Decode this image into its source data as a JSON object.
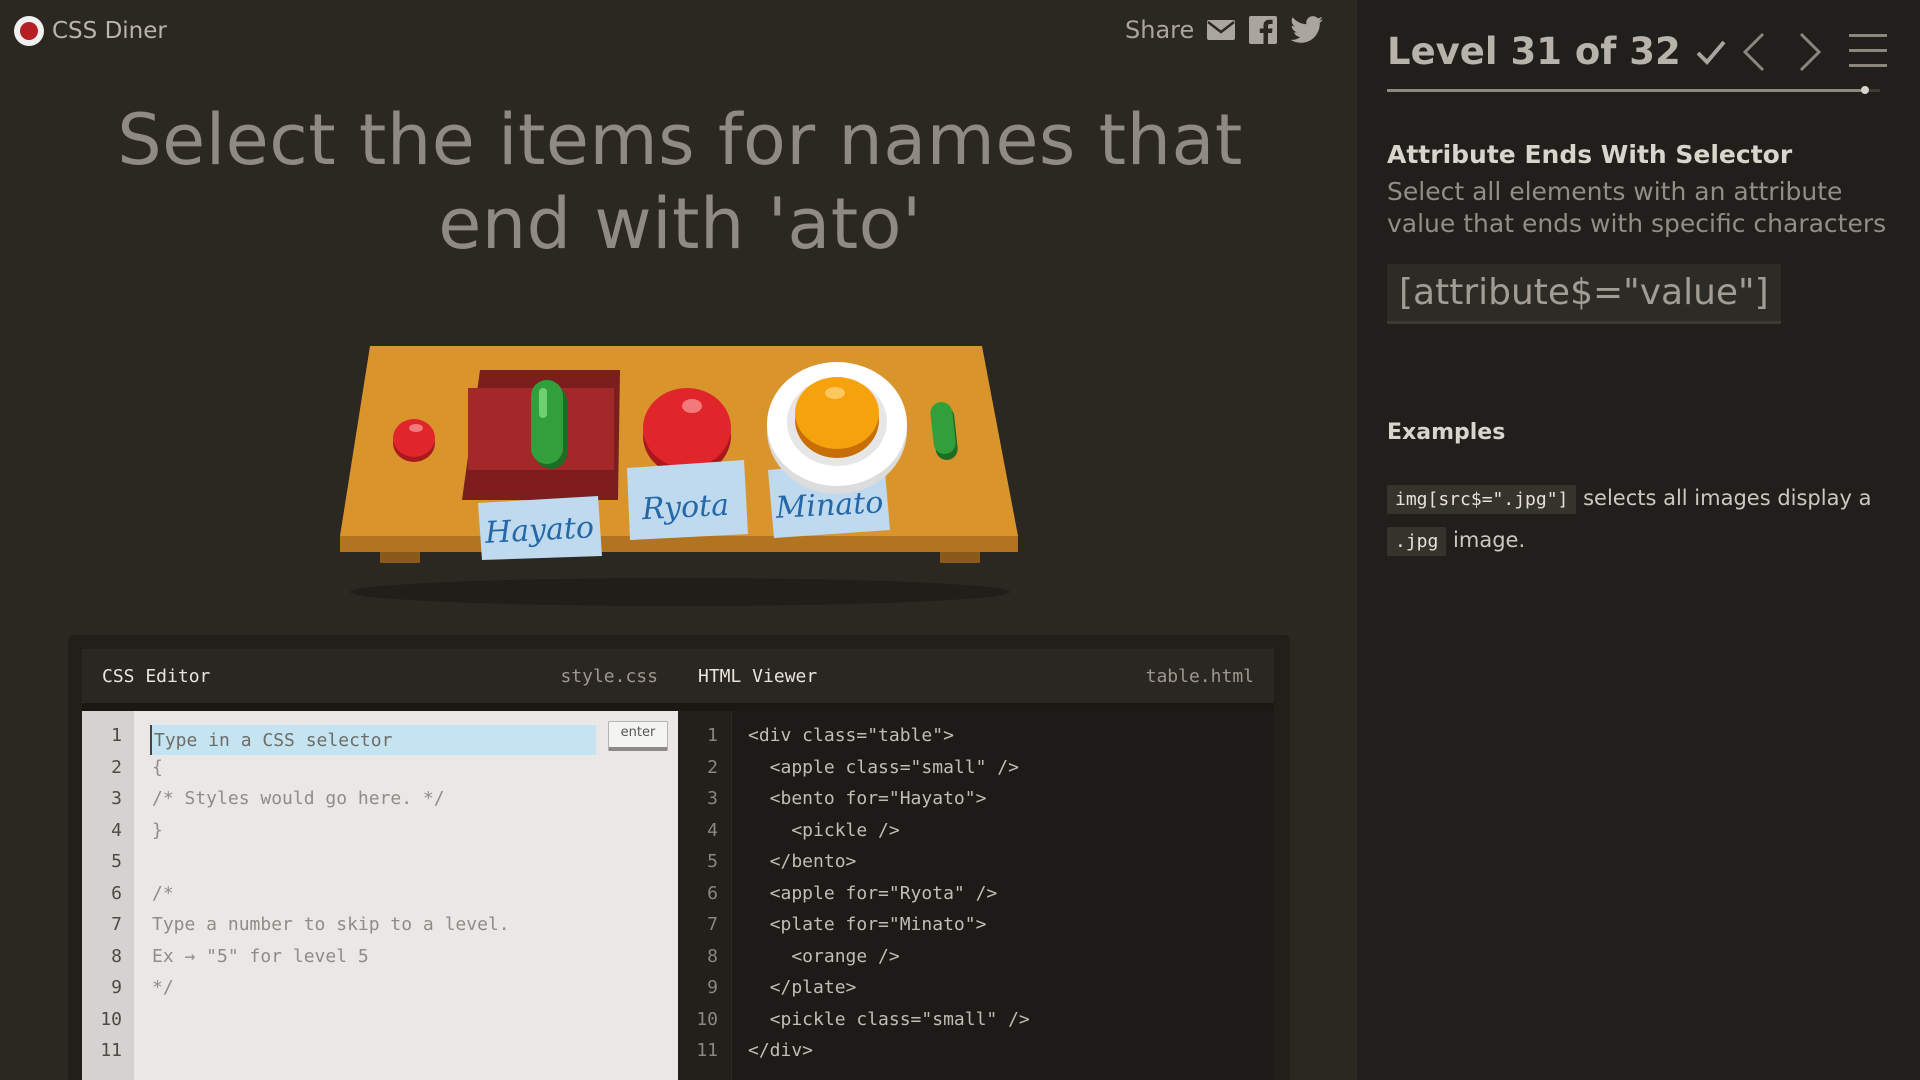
{
  "header": {
    "logo_text": "CSS Diner",
    "share_label": "Share",
    "share_icons": [
      "mail-icon",
      "facebook-icon",
      "twitter-icon"
    ]
  },
  "order": "Select the items for names that end with 'ato'",
  "table_items": [
    {
      "type": "apple",
      "size": "small",
      "color": "#d8262a"
    },
    {
      "type": "bento",
      "name_tag": "Hayato",
      "contains": "pickle",
      "color": "#9c2a2a"
    },
    {
      "type": "apple",
      "name_tag": "Ryota",
      "color": "#d8262a"
    },
    {
      "type": "plate",
      "name_tag": "Minato",
      "contains": "orange",
      "color": "#f5a20c"
    },
    {
      "type": "pickle",
      "size": "small",
      "color": "#2e9d33"
    }
  ],
  "editor": {
    "css_title": "CSS Editor",
    "css_file": "style.css",
    "html_title": "HTML Viewer",
    "html_file": "table.html",
    "input_placeholder": "Type in a CSS selector",
    "enter_label": "enter",
    "line_numbers": [
      "1",
      "2",
      "3",
      "4",
      "5",
      "6",
      "7",
      "8",
      "9",
      "10",
      "11"
    ],
    "css_lines": [
      "",
      "{",
      "/* Styles would go here. */",
      "}",
      "",
      "/*",
      "Type a number to skip to a level.",
      "Ex → \"5\" for level 5",
      "*/",
      "",
      ""
    ],
    "html_lines": [
      "<div class=\"table\">",
      "  <apple class=\"small\" />",
      "  <bento for=\"Hayato\">",
      "    <pickle />",
      "  </bento>",
      "  <apple for=\"Ryota\" />",
      "  <plate for=\"Minato\">",
      "    <orange />",
      "  </plate>",
      "  <pickle class=\"small\" />",
      "</div>"
    ]
  },
  "sidebar": {
    "level_text": "Level 31 of 32",
    "progress": 0.97,
    "selector_name": "Attribute Ends With Selector",
    "selector_desc": "Select all elements with an attribute value that ends with specific characters",
    "syntax": "[attribute$=\"value\"]",
    "examples_title": "Examples",
    "example": {
      "code1": "img[src$=\".jpg\"]",
      "text1": "selects all images display a",
      "code2": ".jpg",
      "text2": "image."
    }
  }
}
